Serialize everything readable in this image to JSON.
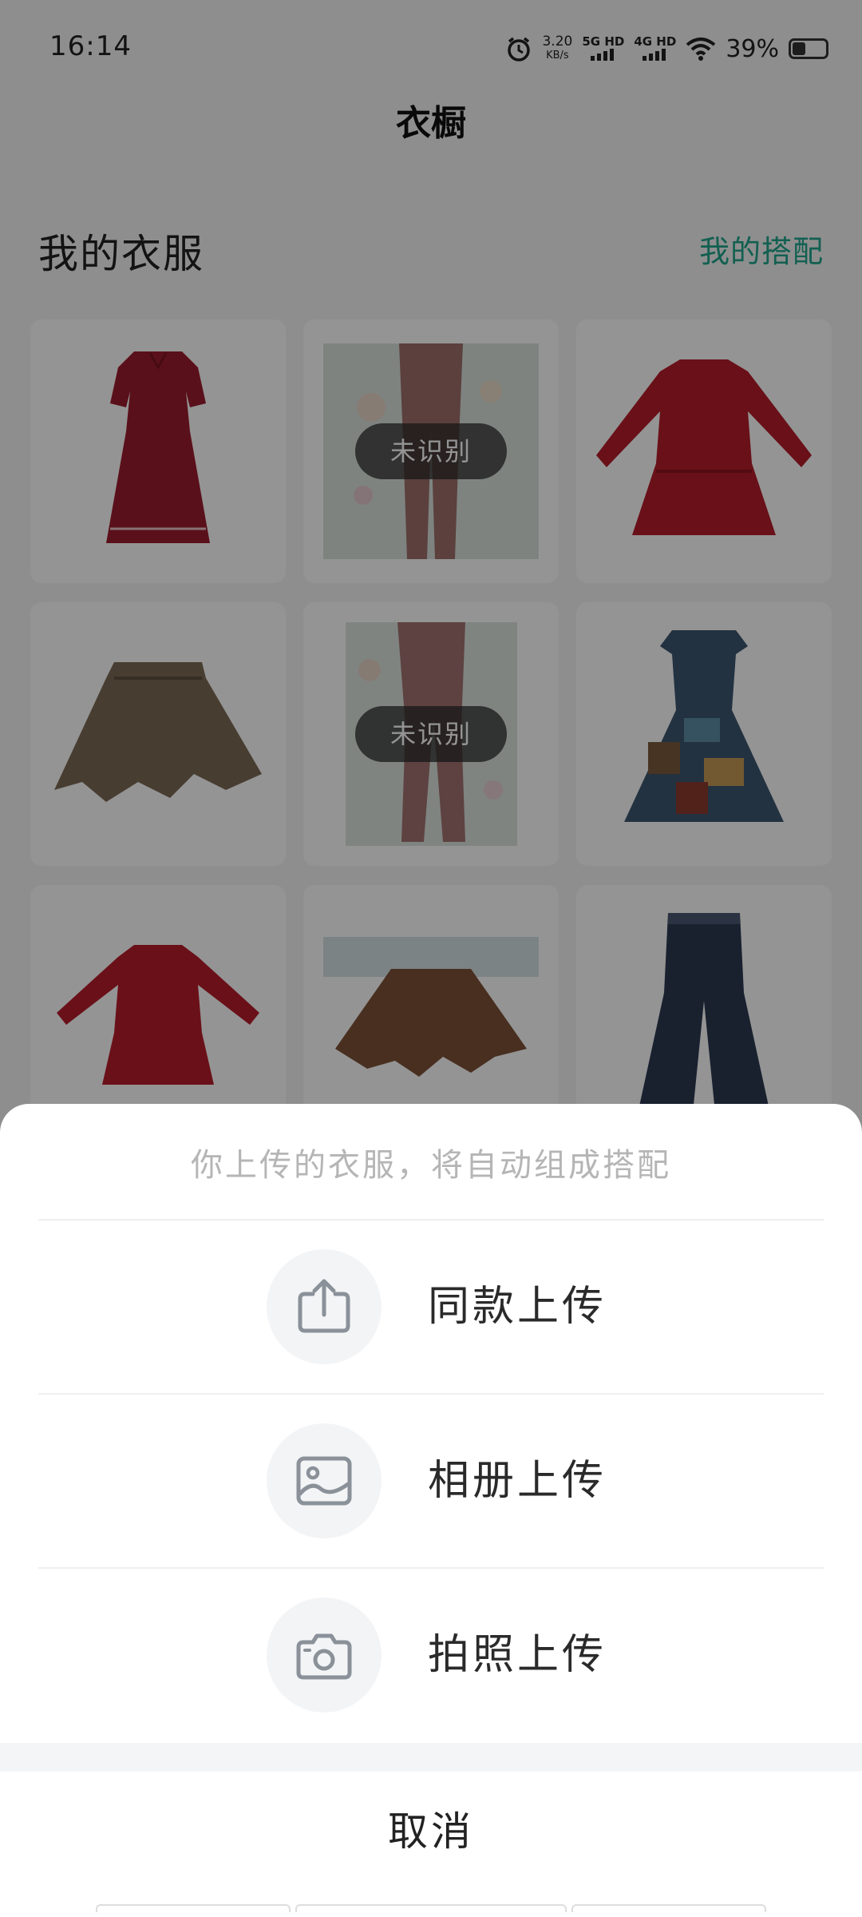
{
  "status_bar": {
    "time": "16:14",
    "net_speed_value": "3.20",
    "net_speed_unit": "KB/s",
    "signal1": "5G HD",
    "signal2": "4G HD",
    "battery_percent": "39%",
    "battery_level": 0.39,
    "icons": [
      "alarm-icon",
      "wifi-icon",
      "battery-icon"
    ]
  },
  "header": {
    "title": "衣橱"
  },
  "section": {
    "title": "我的衣服",
    "outfits_link": "我的搭配"
  },
  "clothes": [
    {
      "item": "red-dress-icon",
      "badge": ""
    },
    {
      "item": "pants-photo-icon",
      "badge": "未识别"
    },
    {
      "item": "red-longsleeve-dress-icon",
      "badge": ""
    },
    {
      "item": "brown-skirt-icon",
      "badge": ""
    },
    {
      "item": "pants-photo-icon",
      "badge": "未识别"
    },
    {
      "item": "printed-dress-icon",
      "badge": ""
    },
    {
      "item": "red-longsleeve-dress-icon",
      "badge": ""
    },
    {
      "item": "brown-ruffle-skirt-icon",
      "badge": ""
    },
    {
      "item": "jeans-icon",
      "badge": ""
    }
  ],
  "sheet": {
    "hint": "你上传的衣服，将自动组成搭配",
    "options": [
      {
        "label": "同款上传",
        "icon": "share-upload-icon"
      },
      {
        "label": "相册上传",
        "icon": "photo-album-icon"
      },
      {
        "label": "拍照上传",
        "icon": "camera-icon"
      }
    ],
    "cancel": "取消"
  },
  "colors": {
    "accent": "#1fa68c",
    "scrim": "rgba(0,0,0,0.42)"
  }
}
